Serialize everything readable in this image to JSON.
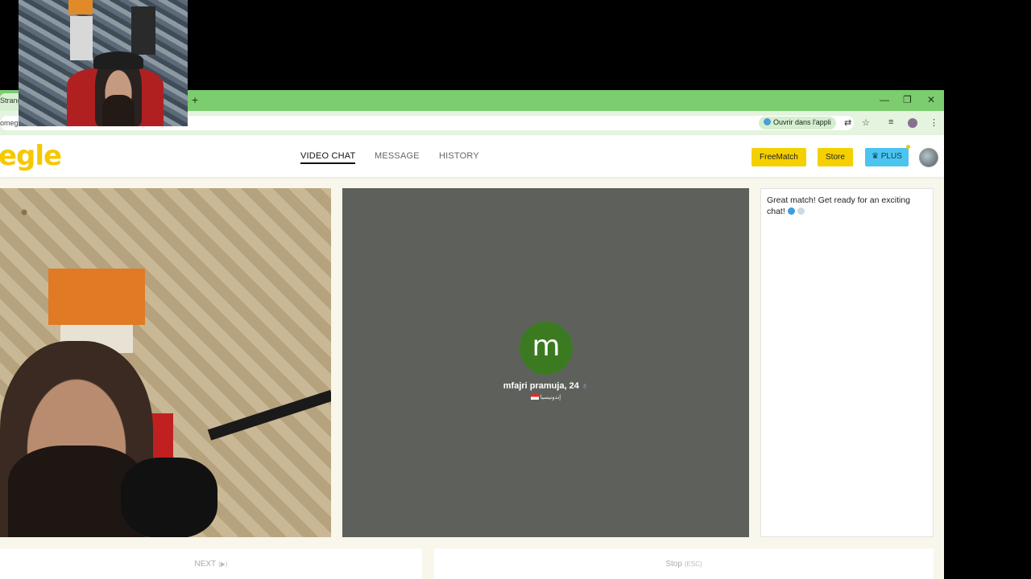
{
  "browser": {
    "tab_title": "Strange",
    "url_text": "omegl",
    "open_in_app": "Ouvrir dans l'appli",
    "new_tab": "+",
    "win_min": "—",
    "win_max": "❐",
    "win_close": "✕"
  },
  "site": {
    "logo": "egle",
    "nav": [
      {
        "label": "VIDEO CHAT",
        "active": true
      },
      {
        "label": "MESSAGE",
        "active": false
      },
      {
        "label": "HISTORY",
        "active": false
      }
    ],
    "freematch_label": "FreeMatch",
    "store_label": "Store",
    "plus_label": "♛ PLUS"
  },
  "remote": {
    "avatar_letter": "m",
    "name": "mfajri pramuja, 24",
    "ring_symbol": "♁",
    "country": "إندونيسيا"
  },
  "chat": {
    "message": "Great match! Get ready for an exciting chat!"
  },
  "controls": {
    "next_label": "NEXT",
    "next_hint": "(▶)",
    "stop_label": "Stop",
    "stop_hint": "(ESC)"
  },
  "colors": {
    "tab_bar": "#7ccc70",
    "logo": "#f5c800",
    "button_yellow": "#f5d000",
    "button_plus": "#4cc4f0",
    "remote_bg": "#5e615b",
    "avatar_green": "#3c7a22"
  }
}
